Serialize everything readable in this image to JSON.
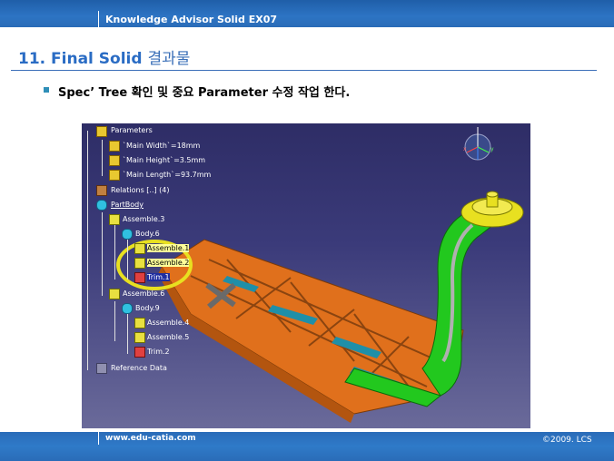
{
  "header": {
    "title": "Knowledge Advisor Solid EX07"
  },
  "slide": {
    "number": "11.",
    "title_en": "Final Solid",
    "title_kr": "결과물",
    "bullet": "Spec’ Tree 확인 및 중요 Parameter 수정 작업 한다."
  },
  "tree": {
    "parameters": "Parameters",
    "param1": "`Main Width`=18mm",
    "param2": "`Main Height`=3.5mm",
    "param3": "`Main Length`=93.7mm",
    "relations": "Relations [..] (4)",
    "partbody": "PartBody",
    "assemble3": "Assemble.3",
    "body6": "Body.6",
    "assemble1": "Assemble.1",
    "assemble2": "Assemble.2",
    "trim1": "Trim.1",
    "assemble6": "Assemble.6",
    "body9": "Body.9",
    "assemble4": "Assemble.4",
    "assemble5": "Assemble.5",
    "trim2": "Trim.2",
    "reference": "Reference Data"
  },
  "footer": {
    "url": "www.edu-catia.com",
    "copyright": "©2009. LCS"
  },
  "colors": {
    "accent": "#2a6cc4",
    "part_orange": "#e0701c",
    "part_green": "#22c81e",
    "part_yellow": "#e8e020"
  }
}
